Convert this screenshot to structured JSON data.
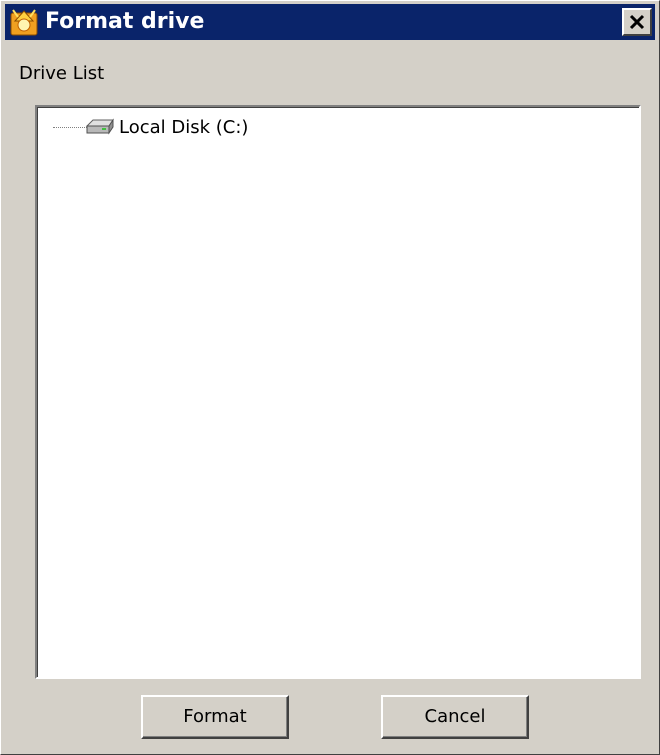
{
  "window": {
    "title": "Format drive",
    "app_icon": "format-drive-app-icon",
    "close_icon": "close-icon"
  },
  "drive_list": {
    "label": "Drive List",
    "items": [
      {
        "label": "Local Disk (C:)",
        "icon": "hard-drive-icon"
      }
    ]
  },
  "buttons": {
    "format_label": "Format",
    "cancel_label": "Cancel"
  },
  "colors": {
    "titlebar": "#0a246a",
    "face": "#d4d0c8",
    "list_background": "#ffffff"
  }
}
